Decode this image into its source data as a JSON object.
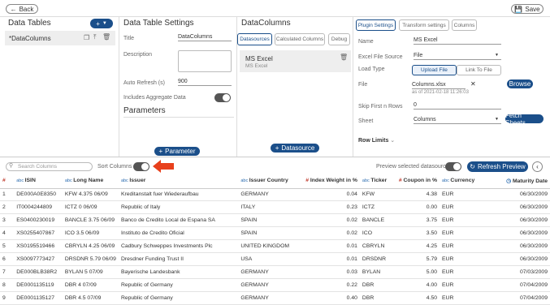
{
  "back_label": "Back",
  "save_label": "Save",
  "left": {
    "title": "Data Tables",
    "item": "*DataColumns"
  },
  "settings": {
    "title": "Data Table Settings",
    "title_label": "Title",
    "title_value": "DataColumns",
    "desc_label": "Description",
    "auto_label": "Auto Refresh (s)",
    "auto_value": "900",
    "agg_label": "Includes Aggregate Data",
    "params_title": "Parameters",
    "param_btn": "Parameter"
  },
  "dc": {
    "title": "DataColumns",
    "tabs": [
      "Datasources",
      "Calculated Columns",
      "Debug"
    ],
    "source_name": "MS Excel",
    "source_sub": "MS Excel",
    "ds_btn": "Datasource"
  },
  "plugin": {
    "tabs": [
      "Plugin Settings",
      "Transform settings",
      "Columns"
    ],
    "name_label": "Name",
    "name_value": "MS Excel",
    "src_label": "Excel File Source",
    "src_value": "File",
    "load_label": "Load Type",
    "load_opts": [
      "Upload File",
      "Link To File"
    ],
    "file_label": "File",
    "file_name": "Columns.xlsx",
    "file_date": "as of 2021-02-18 11:26:03",
    "browse": "Browse",
    "skip_label": "Skip First n Rows",
    "skip_value": "0",
    "sheet_label": "Sheet",
    "sheet_value": "Columns",
    "fetch": "Fetch Sheets",
    "row_limits": "Row Limits"
  },
  "toolbar": {
    "search_ph": "Search Columns",
    "sort_label": "Sort Columns",
    "preview_label": "Preview selected datasource",
    "refresh": "Refresh Preview"
  },
  "columns": [
    {
      "type": "#",
      "name": ""
    },
    {
      "type": "abc",
      "name": "ISIN"
    },
    {
      "type": "abc",
      "name": "Long Name"
    },
    {
      "type": "abc",
      "name": "Issuer"
    },
    {
      "type": "abc",
      "name": "Issuer Country"
    },
    {
      "type": "#",
      "name": "Index Weight in %"
    },
    {
      "type": "abc",
      "name": "Ticker"
    },
    {
      "type": "#",
      "name": "Coupon in %"
    },
    {
      "type": "abc",
      "name": "Currency"
    },
    {
      "type": "clock",
      "name": "Maturity Date"
    }
  ],
  "rows": [
    [
      "1",
      "DE000A0E8350",
      "KFW 4.375 06/09",
      "Kreditanstalt fuer Wiederaufbau",
      "GERMANY",
      "0.04",
      "KFW",
      "4.38",
      "EUR",
      "06/30/2009"
    ],
    [
      "2",
      "IT0004244809",
      "ICTZ 0 06/09",
      "Republic of Italy",
      "ITALY",
      "0.23",
      "ICTZ",
      "0.00",
      "EUR",
      "06/30/2009"
    ],
    [
      "3",
      "ES0400230019",
      "BANCLE 3.75 06/09",
      "Banco de Credito Local de Espana SA",
      "SPAIN",
      "0.02",
      "BANCLE",
      "3.75",
      "EUR",
      "06/30/2009"
    ],
    [
      "4",
      "XS0255407867",
      "ICO 3.5 06/09",
      "Instituto de Credito Oficial",
      "SPAIN",
      "0.02",
      "ICO",
      "3.50",
      "EUR",
      "06/30/2009"
    ],
    [
      "5",
      "XS0195519466",
      "CBRYLN 4.25 06/09",
      "Cadbury Schweppes Investments Plc",
      "UNITED KINGDOM",
      "0.01",
      "CBRYLN",
      "4.25",
      "EUR",
      "06/30/2009"
    ],
    [
      "6",
      "XS0097773427",
      "DRSDNR 5.79 06/09",
      "Dresdner Funding Trust II",
      "USA",
      "0.01",
      "DRSDNR",
      "5.79",
      "EUR",
      "06/30/2009"
    ],
    [
      "7",
      "DE000BLB38R2",
      "BYLAN 5 07/09",
      "Bayerische Landesbank",
      "GERMANY",
      "0.03",
      "BYLAN",
      "5.00",
      "EUR",
      "07/03/2009"
    ],
    [
      "8",
      "DE0001135119",
      "DBR 4 07/09",
      "Republic of Germany",
      "GERMANY",
      "0.22",
      "DBR",
      "4.00",
      "EUR",
      "07/04/2009"
    ],
    [
      "9",
      "DE0001135127",
      "DBR 4.5 07/09",
      "Republic of Germany",
      "GERMANY",
      "0.40",
      "DBR",
      "4.50",
      "EUR",
      "07/04/2009"
    ]
  ],
  "colors": {
    "navy": "#1b4f8a",
    "red": "#c0392b",
    "arrow": "#e8401c"
  }
}
